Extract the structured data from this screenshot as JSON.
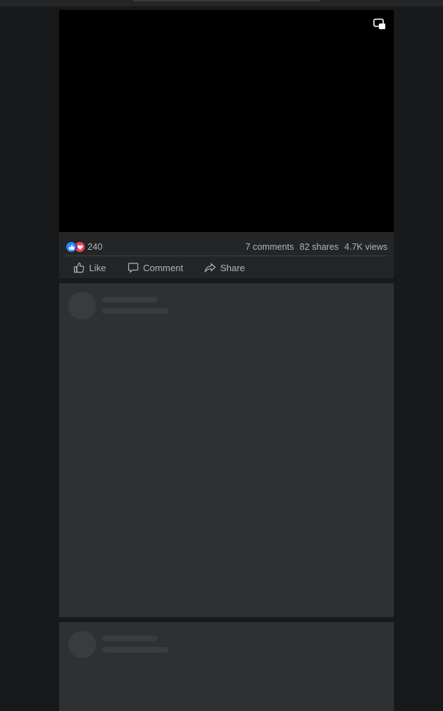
{
  "post": {
    "reactions": {
      "count": "240",
      "icons": [
        "like-icon",
        "love-icon"
      ]
    },
    "comments": "7 comments",
    "shares": "82 shares",
    "views": "4.7K views",
    "actions": {
      "like_label": "Like",
      "comment_label": "Comment",
      "share_label": "Share"
    },
    "video_controls": {
      "pip_icon": "picture-in-picture-icon"
    }
  },
  "colors": {
    "page_background": "#18191a",
    "card_background": "#242526",
    "skeleton_card": "#2f3031",
    "skeleton_shape": "#3a3b3c",
    "secondary_text": "#b0b3b8",
    "like_blue": "#2d88ff",
    "love_red": "#f33e58",
    "video_background": "#000000"
  },
  "skeleton_posts": [
    {
      "state": "loading"
    },
    {
      "state": "loading"
    }
  ]
}
